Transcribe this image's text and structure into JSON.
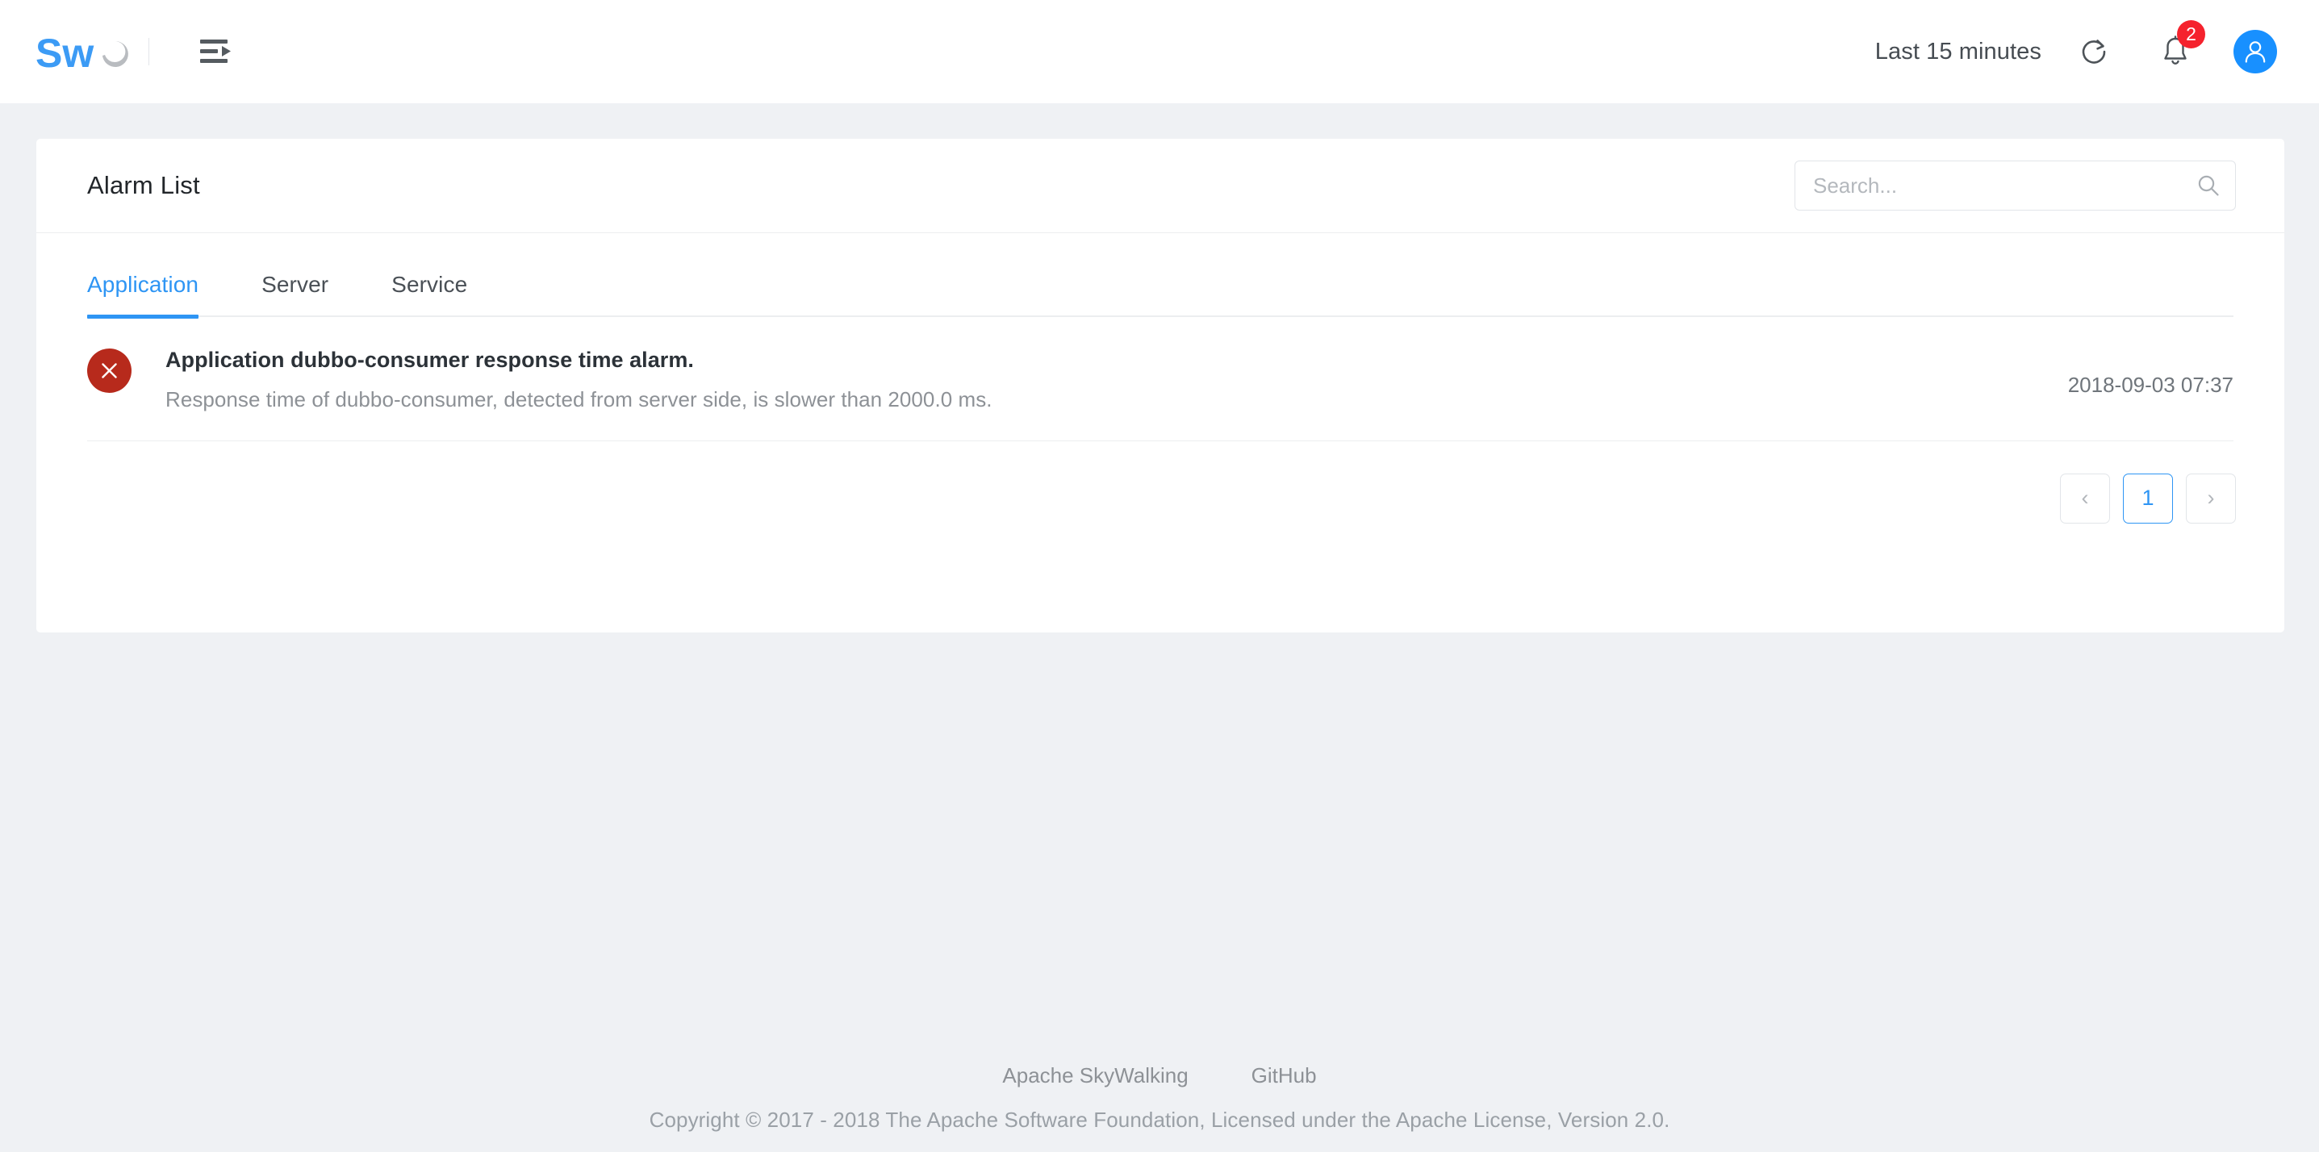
{
  "header": {
    "logo_alt": "SkyWalking",
    "menu_icon": "menu-collapse-icon",
    "time_range": "Last 15 minutes",
    "refresh_icon": "refresh-icon",
    "bell_icon": "bell-icon",
    "notification_count": "2",
    "avatar_icon": "user-avatar-icon"
  },
  "card": {
    "title": "Alarm List",
    "search": {
      "value": "",
      "placeholder": "Search...",
      "icon": "search-icon"
    },
    "tabs": [
      {
        "label": "Application",
        "active": true
      },
      {
        "label": "Server",
        "active": false
      },
      {
        "label": "Service",
        "active": false
      }
    ],
    "alarms": [
      {
        "severity_icon": "error-close-icon",
        "severity_color": "#b72a1c",
        "title": "Application dubbo-consumer response time alarm.",
        "description": "Response time of dubbo-consumer, detected from server side, is slower than 2000.0 ms.",
        "time": "2018-09-03 07:37"
      }
    ],
    "pagination": {
      "prev_label": "‹",
      "next_label": "›",
      "pages": [
        "1"
      ],
      "current": "1"
    }
  },
  "footer": {
    "links": [
      {
        "label": "Apache SkyWalking"
      },
      {
        "label": "GitHub"
      }
    ],
    "copyright": "Copyright © 2017 - 2018 The Apache Software Foundation, Licensed under the Apache License, Version 2.0."
  },
  "colors": {
    "accent": "#2e95f4",
    "page_bg": "#eff1f4",
    "card_bg": "#ffffff",
    "danger": "#b72a1c",
    "badge": "#f5222d",
    "avatar": "#1890ff"
  }
}
